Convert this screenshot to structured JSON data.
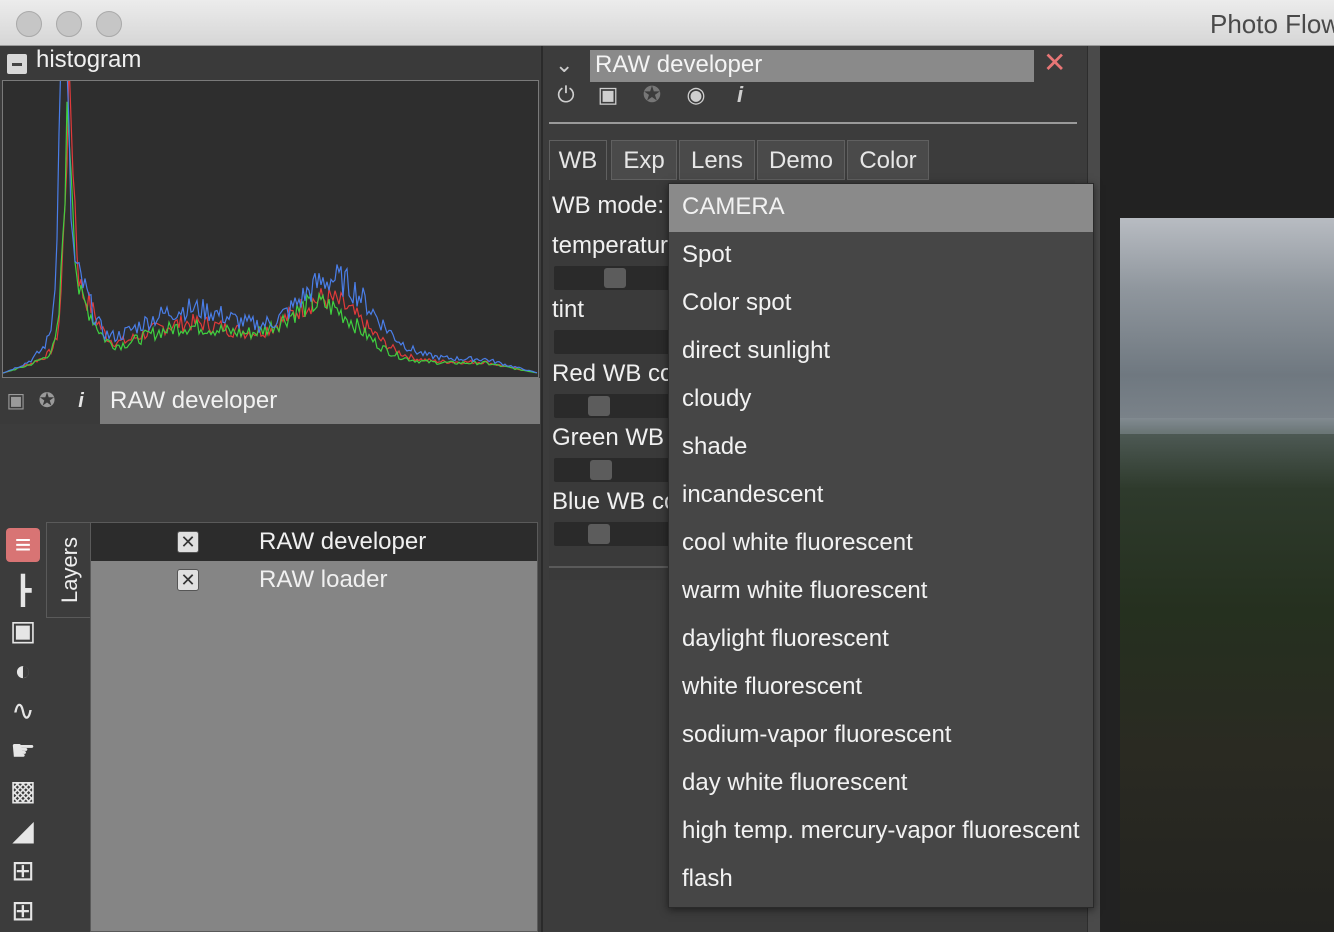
{
  "window": {
    "title": "Photo Flow"
  },
  "histogram": {
    "title": "histogram"
  },
  "layer_toolbar": {
    "selected_layer_name": "RAW developer"
  },
  "tools": {
    "tab_label": "Layers"
  },
  "layers": [
    {
      "name": "RAW developer",
      "visible": true,
      "selected": true
    },
    {
      "name": "RAW loader",
      "visible": true,
      "selected": false
    }
  ],
  "panel": {
    "title": "RAW developer",
    "tabs": [
      "WB",
      "Exp",
      "Lens",
      "Demo",
      "Color"
    ],
    "active_tab": "WB",
    "params": {
      "wb_mode_label": "WB mode:",
      "temperature_label": "temperature",
      "tint_label": "tint",
      "red_label": "Red WB co",
      "green_label": "Green WB",
      "blue_label": "Blue WB co"
    }
  },
  "wb_menu": {
    "selected": "CAMERA",
    "options": [
      "CAMERA",
      "Spot",
      "Color spot",
      "direct sunlight",
      "cloudy",
      "shade",
      "incandescent",
      "cool white fluorescent",
      "warm white fluorescent",
      "daylight fluorescent",
      "white fluorescent",
      "sodium-vapor fluorescent",
      "day white fluorescent",
      "high temp. mercury-vapor fluorescent",
      "flash"
    ]
  },
  "colors": {
    "accent_close": "#e87676",
    "histogram_red": "#e03a3a",
    "histogram_green": "#3fd03f",
    "histogram_blue": "#4a7ee8"
  }
}
